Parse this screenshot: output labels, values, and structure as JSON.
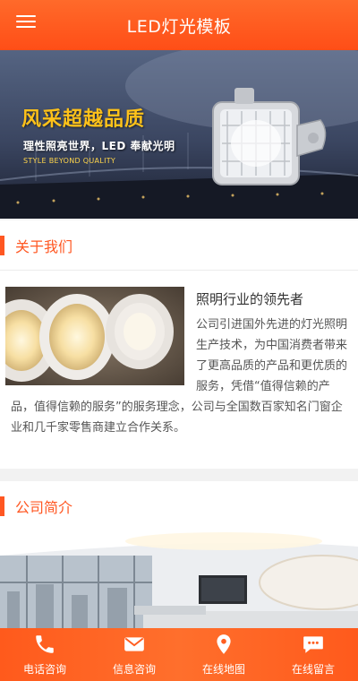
{
  "header": {
    "title": "LED灯光模板",
    "menu_icon": "hamburger-menu-icon"
  },
  "banner": {
    "headline": "风采超越品质",
    "subtitle": "理性照亮世界，LED 奉献光明",
    "english": "STYLE BEYOND QUALITY",
    "slide_count": 2,
    "active_slide": 1
  },
  "about": {
    "section_title": "关于我们",
    "headline": "照明行业的领先者",
    "body": "公司引进国外先进的灯光照明生产技术，为中国消费者带来了更高品质的产品和更优质的服务，凭借“值得信赖的产品，值得信赖的服务”的服务理念，公司与全国数百家知名门窗企业和几千家零售商建立合作关系。"
  },
  "intro": {
    "section_title": "公司简介"
  },
  "footer": {
    "items": [
      {
        "label": "电话咨询",
        "icon": "phone-icon"
      },
      {
        "label": "信息咨询",
        "icon": "mail-icon"
      },
      {
        "label": "在线地图",
        "icon": "map-pin-icon"
      },
      {
        "label": "在线留言",
        "icon": "chat-icon"
      }
    ]
  },
  "colors": {
    "accent": "#ff5722",
    "header": "#ff5a1e",
    "banner_title": "#ffc21a"
  }
}
